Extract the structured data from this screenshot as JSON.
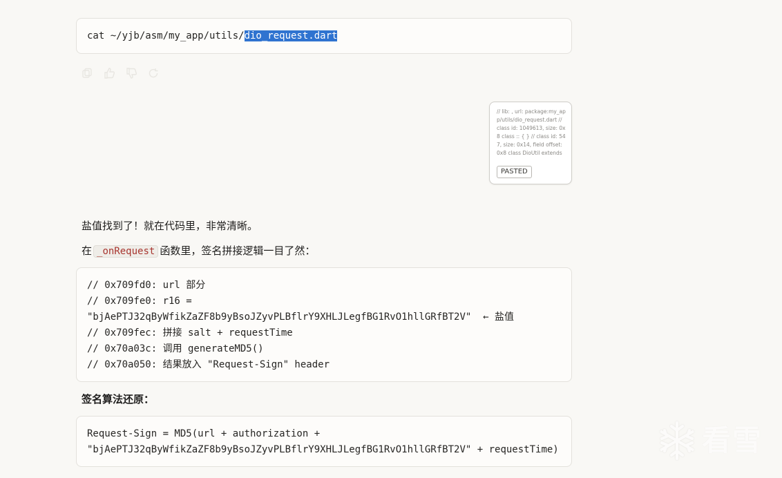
{
  "command_block": {
    "prefix": "cat ~/yjb/asm/my_app/utils/",
    "selected": "dio_request.dart"
  },
  "message_actions": [
    {
      "name": "copy-icon"
    },
    {
      "name": "thumbs-up-icon"
    },
    {
      "name": "thumbs-down-icon"
    },
    {
      "name": "retry-icon"
    }
  ],
  "pasted_card": {
    "preview": "// lib: , url: package:my_app/utils/dio_request.dart // class id: 1049613, size: 0x8 class :: { } // class id: 547, size: 0x14, field offset: 0x8 class DioUtil extends Obj...",
    "badge": "PASTED"
  },
  "response": {
    "p1": "盐值找到了！就在代码里，非常清晰。",
    "p2_before": "在",
    "p2_code": "_onRequest",
    "p2_after": "函数里，签名拼接逻辑一目了然：",
    "code_lines": [
      "// 0x709fd0: url 部分",
      "// 0x709fe0: r16 =",
      "\"bjAePTJ32qByWfikZaZF8b9yBsoJZyvPLBflrY9XHLJLegfBG1RvO1hllGRfBT2V\"  ← 盐值",
      "// 0x709fec: 拼接 salt + requestTime",
      "// 0x70a03c: 调用 generateMD5()",
      "// 0x70a050: 结果放入 \"Request-Sign\" header"
    ],
    "heading": "签名算法还原：",
    "formula_lines": [
      "Request-Sign = MD5(url + authorization +",
      "\"bjAePTJ32qByWfikZaZF8b9yBsoJZyvPLBflrY9XHLJLegfBG1RvO1hllGRfBT2V\" + requestTime)"
    ]
  },
  "watermark": {
    "text": "看雪"
  }
}
